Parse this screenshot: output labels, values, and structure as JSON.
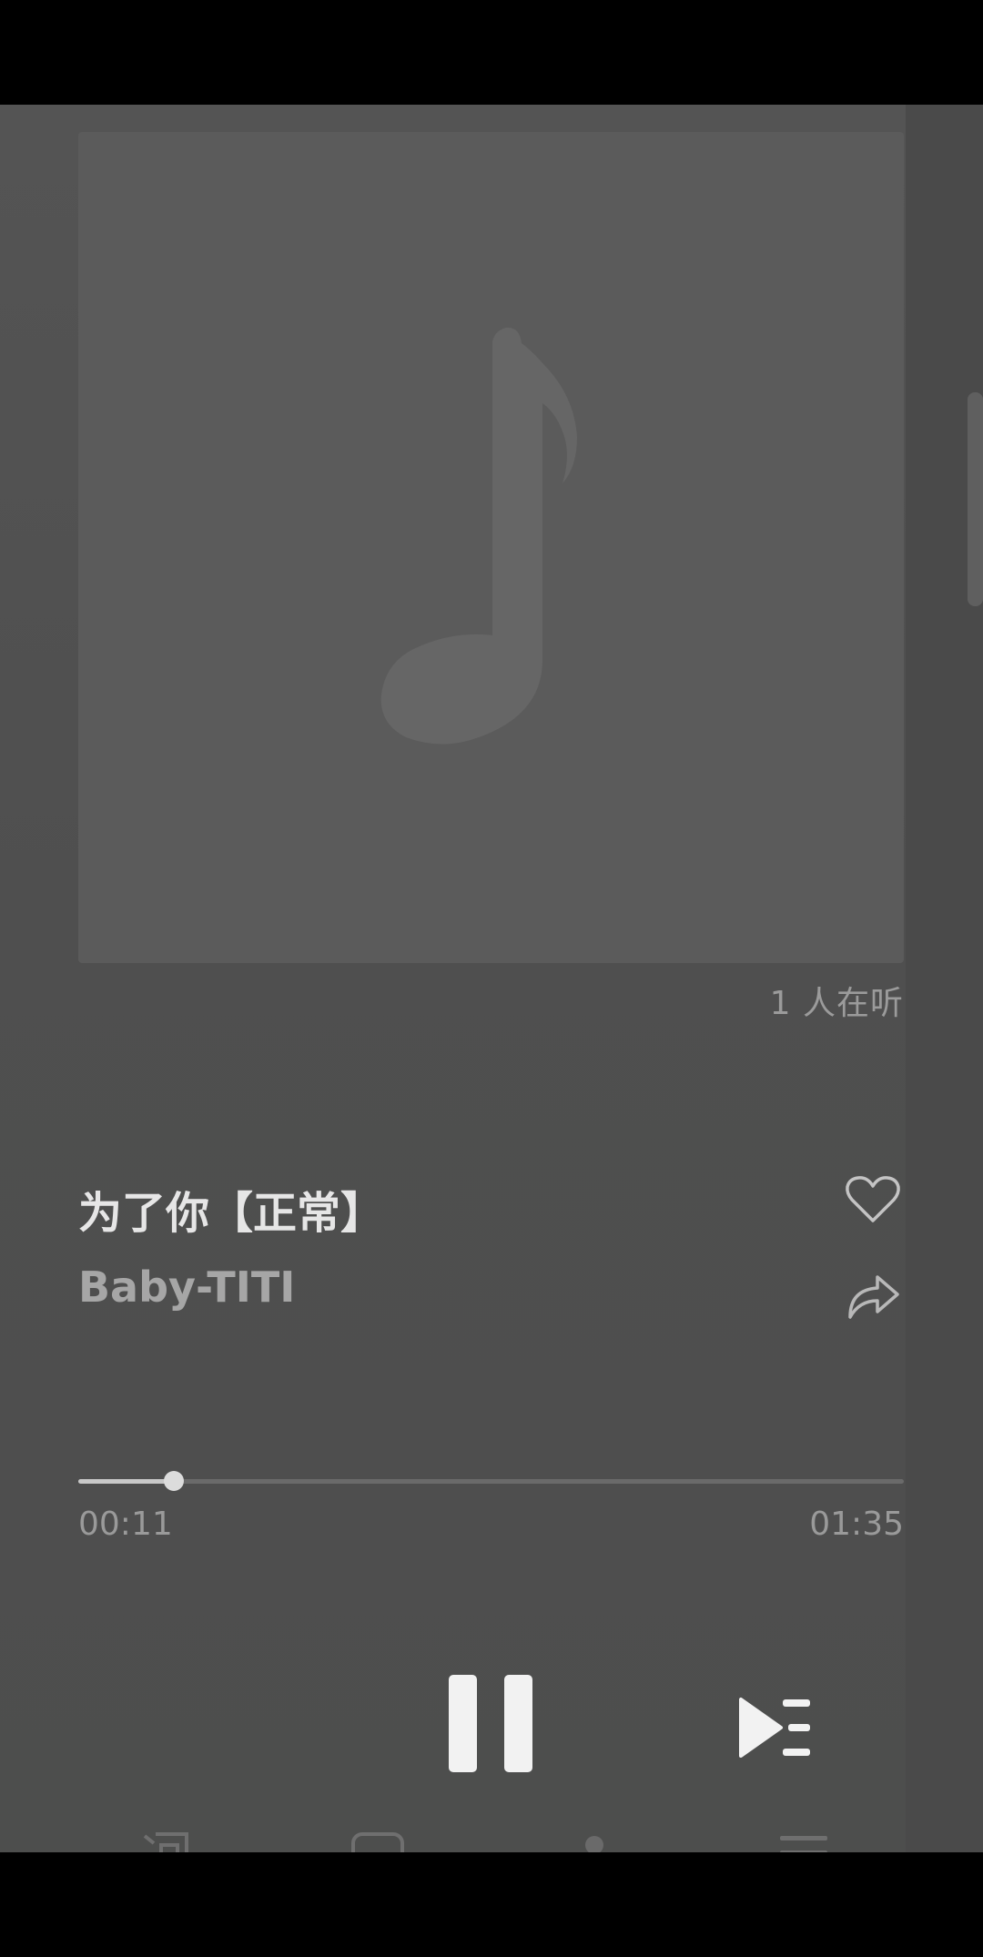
{
  "player": {
    "listeners_text": "1 人在听",
    "song_title": "为了你【正常】",
    "artist": "Baby-TITI",
    "current_time": "00:11",
    "total_time": "01:35",
    "progress_fraction": 0.116
  },
  "icons": {
    "artwork": "music-note-icon",
    "like": "heart-icon",
    "share": "share-arrow-icon",
    "pause": "pause-icon",
    "next": "play-next-icon",
    "nav": [
      "lyrics-icon",
      "device-icon",
      "user-icon",
      "playlist-icon"
    ]
  },
  "colors": {
    "background": "#4f4f4f",
    "artwork_placeholder": "#5b5b5b",
    "primary_text": "#e6e6e6",
    "secondary_text": "#a6a6a6"
  }
}
